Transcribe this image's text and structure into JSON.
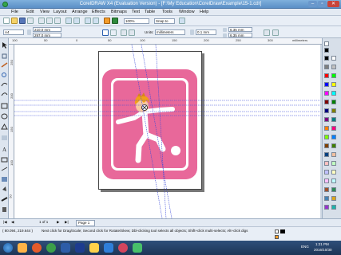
{
  "window": {
    "title": "CorelDRAW X4 (Evaluation Version) - [F:\\My Education\\CorelDraw\\Example\\15-1.cdr]"
  },
  "window_controls": {
    "minimize": "–",
    "maximize": "▫",
    "close": "✕"
  },
  "menu": [
    "File",
    "Edit",
    "View",
    "Layout",
    "Arrange",
    "Effects",
    "Bitmaps",
    "Text",
    "Table",
    "Tools",
    "Window",
    "Help"
  ],
  "property_bar": {
    "paper_size": "A4",
    "width": "210.0 mm",
    "height": "297.0 mm",
    "units_label": "Units:",
    "units_value": "millimeters",
    "nudge": "0.1 mm",
    "dup_x": "6.35 mm",
    "dup_y": "6.35 mm"
  },
  "standard_bar": {
    "zoom": "100%",
    "snap_to": "Snap to"
  },
  "ruler": {
    "top_numbers": [
      "100",
      "50",
      "0",
      "50",
      "100",
      "150",
      "200",
      "250",
      "300"
    ],
    "left_numbers": [
      "250",
      "200",
      "150",
      "100",
      "50"
    ],
    "units": "millimeters"
  },
  "page_nav": {
    "position": "1 of 1",
    "tab": "Page 1"
  },
  "status": {
    "coords": "( 80.094, 219.644 )",
    "hint": "Next click for Drag/Scale; Second click for Rotate/Skew; Dbl-clicking tool selects all objects; Shift+click multi-selects; Alt+click digs"
  },
  "taskbar": {
    "lang": "ENG",
    "time": "1:21 PM",
    "date": "2016/10/30"
  },
  "colors": {
    "sign_pink": "#e8689a",
    "skin": "#f7c8a0",
    "hair": "#f2a018",
    "guide_blue": "#3a4ad8"
  },
  "palette_colors": [
    "#000000",
    "#ffffff",
    "#7f7f7f",
    "#c0c0c0",
    "#ff0000",
    "#00ff00",
    "#0000ff",
    "#ffff00",
    "#ff00ff",
    "#00ffff",
    "#800000",
    "#008000",
    "#000080",
    "#808000",
    "#800080",
    "#008080",
    "#ff8000",
    "#ff0080",
    "#80ff00",
    "#0080ff",
    "#804000",
    "#408000",
    "#004080",
    "#f0c0a0",
    "#ffc0c0",
    "#c0ffc0",
    "#c0c0ff",
    "#ffffc0",
    "#ffc0ff",
    "#c0ffff",
    "#a0522d",
    "#2e8b57",
    "#4682b4",
    "#daa520",
    "#9932cc",
    "#20b2aa"
  ]
}
